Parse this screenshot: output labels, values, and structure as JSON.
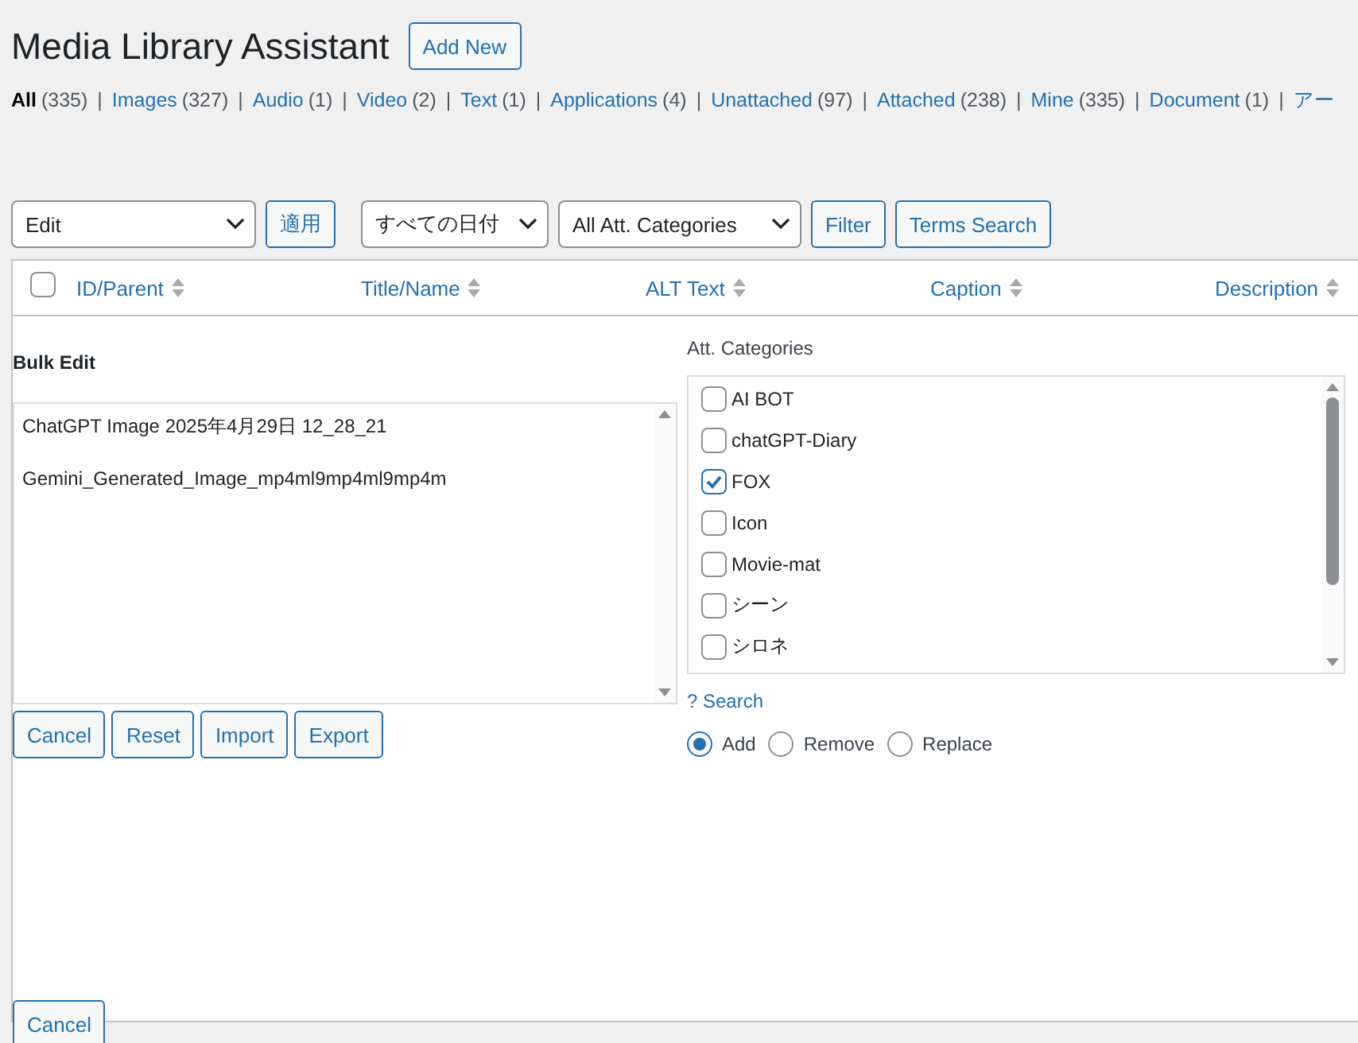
{
  "page_title": "Media Library Assistant",
  "add_new": "Add New",
  "filters": [
    {
      "label": "All",
      "count": "(335)",
      "selected": true
    },
    {
      "label": "Images",
      "count": "(327)",
      "selected": false
    },
    {
      "label": "Audio",
      "count": "(1)",
      "selected": false
    },
    {
      "label": "Video",
      "count": "(2)",
      "selected": false
    },
    {
      "label": "Text",
      "count": "(1)",
      "selected": false
    },
    {
      "label": "Applications",
      "count": "(4)",
      "selected": false
    },
    {
      "label": "Unattached",
      "count": "(97)",
      "selected": false
    },
    {
      "label": "Attached",
      "count": "(238)",
      "selected": false
    },
    {
      "label": "Mine",
      "count": "(335)",
      "selected": false
    },
    {
      "label": "Document",
      "count": "(1)",
      "selected": false
    },
    {
      "label": "アー",
      "selected": false
    }
  ],
  "filter_separator": "|",
  "select_all_checked": false,
  "toolbar": {
    "bulk_action": "Edit",
    "apply": "適用",
    "date_filter": "すべての日付",
    "category_filter": "All Att. Categories",
    "filter": "Filter",
    "terms_search": "Terms Search"
  },
  "columns": [
    "ID/Parent",
    "Title/Name",
    "ALT Text",
    "Caption",
    "Description"
  ],
  "bulk_edit": {
    "title": "Bulk Edit",
    "items": [
      "ChatGPT Image 2025年4月29日 12_28_21",
      "Gemini_Generated_Image_mp4ml9mp4ml9mp4m"
    ],
    "buttons": [
      "Cancel",
      "Reset",
      "Import",
      "Export"
    ],
    "categories_label": "Att. Categories",
    "categories": [
      {
        "label": "AI BOT",
        "checked": false
      },
      {
        "label": "chatGPT-Diary",
        "checked": false
      },
      {
        "label": "FOX",
        "checked": true
      },
      {
        "label": "Icon",
        "checked": false
      },
      {
        "label": "Movie-mat",
        "checked": false
      },
      {
        "label": "シーン",
        "checked": false
      },
      {
        "label": "シロネ",
        "checked": false
      }
    ],
    "search_link": "? Search",
    "modes": [
      {
        "label": "Add",
        "selected": true
      },
      {
        "label": "Remove",
        "selected": false
      },
      {
        "label": "Replace",
        "selected": false
      }
    ],
    "bottom_cancel": "Cancel"
  }
}
